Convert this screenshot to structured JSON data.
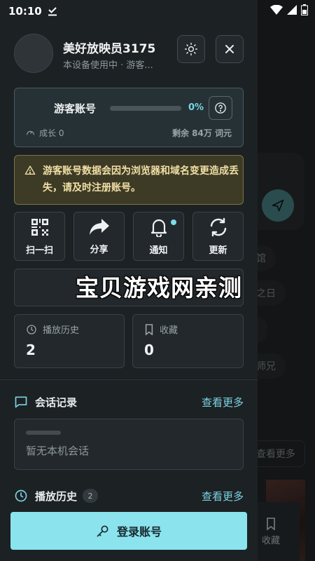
{
  "status_bar": {
    "time": "10:10"
  },
  "profile": {
    "name": "美好放映员3175",
    "subtitle": "本设备使用中 · 游客..."
  },
  "guest_card": {
    "title": "游客账号",
    "progress_percent": 0,
    "progress_label": "0%",
    "growth_label": "成长 0",
    "remaining_label": "剩余 84万 词元"
  },
  "warning": {
    "text": "游客账号数据会因为浏览器和域名变更造成丢失，请及时注册账号。"
  },
  "quick_actions": [
    {
      "label": "扫一扫",
      "icon": "qr-code-icon"
    },
    {
      "label": "分享",
      "icon": "share-icon"
    },
    {
      "label": "通知",
      "icon": "bell-icon"
    },
    {
      "label": "更新",
      "icon": "refresh-icon"
    }
  ],
  "stats": {
    "history": {
      "label": "播放历史",
      "value": "2"
    },
    "favorites": {
      "label": "收藏",
      "value": "0"
    }
  },
  "sessions": {
    "title": "会话记录",
    "more": "查看更多",
    "empty_text": "暂无本机会话"
  },
  "play_history": {
    "title": "播放历史",
    "count": "2",
    "more": "查看更多"
  },
  "login_button": {
    "label": "登录账号"
  },
  "watermark": "宝贝游戏网亲测",
  "background": {
    "chips": [
      "馆",
      "之日",
      "师兄"
    ],
    "more": "查看更多",
    "fav_label": "收藏"
  },
  "colors": {
    "accent": "#8be3ee",
    "warning_bg": "#3d3a26",
    "drawer_bg": "#1c2124"
  }
}
